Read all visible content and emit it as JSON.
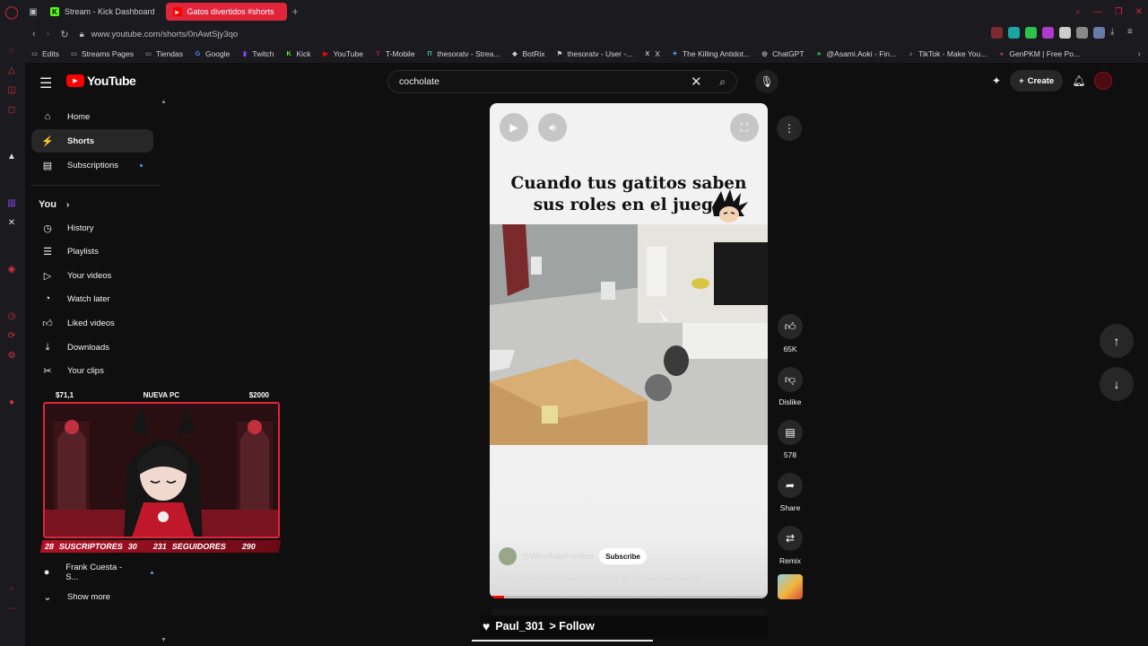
{
  "browser": {
    "tabs": [
      {
        "label": "Stream - Kick Dashboard",
        "active": false
      },
      {
        "label": "Gatos divertidos #shorts",
        "active": true
      }
    ],
    "url": "www.youtube.com/shorts/0nAwtSjy3qo",
    "bookmarks": [
      "Edits",
      "Streams Pages",
      "Tiendas",
      "Google",
      "Twitch",
      "Kick",
      "YouTube",
      "T-Mobile",
      "thesoratv - Strea...",
      "BotRix",
      "thesoratv - User -...",
      "X",
      "The Killing Antidot...",
      "ChatGPT",
      "@Asami.Aoki - Fin...",
      "TikTok - Make You...",
      "GenPKM | Free Po..."
    ]
  },
  "youtube": {
    "logo_text": "YouTube",
    "search_query": "cocholate",
    "create_label": "Create",
    "sidebar_top": [
      {
        "label": "Home",
        "icon": "home-icon"
      },
      {
        "label": "Shorts",
        "icon": "shorts-icon",
        "active": true
      },
      {
        "label": "Subscriptions",
        "icon": "subscriptions-icon",
        "dot": true
      }
    ],
    "you_label": "You",
    "sidebar_you": [
      {
        "label": "History",
        "icon": "history-icon"
      },
      {
        "label": "Playlists",
        "icon": "playlists-icon"
      },
      {
        "label": "Your videos",
        "icon": "your-videos-icon"
      },
      {
        "label": "Watch later",
        "icon": "watch-later-icon"
      },
      {
        "label": "Liked videos",
        "icon": "liked-videos-icon"
      },
      {
        "label": "Downloads",
        "icon": "downloads-icon"
      },
      {
        "label": "Your clips",
        "icon": "clips-icon"
      }
    ],
    "sidebar_bottom": [
      {
        "label": "Frank Cuesta - S...",
        "icon": "channel-avatar-icon",
        "dot": true
      },
      {
        "label": "Show more",
        "icon": "chevron-down-icon"
      }
    ]
  },
  "overlay": {
    "left_value": "$71,1",
    "center_text": "NUEVA PC",
    "right_value": "$2000",
    "subs_count": "28",
    "subs_label": "SUSCRIPTORES",
    "subs_goal": "30",
    "followers_count": "231",
    "followers_label": "SEGUIDORES",
    "followers_goal": "290"
  },
  "short": {
    "caption_line1": "Cuando tus gatitos saben",
    "caption_line2": "sus roles en el juego",
    "channel_handle": "@WhoAlanFonfico",
    "subscribe_label": "Subscribe",
    "title_text": "Gatos divertidos",
    "title_tags": "#shorts #viralshorts #dragonballz #goku",
    "progress": 0.05,
    "actions": [
      {
        "label": "65K",
        "icon": "like-icon"
      },
      {
        "label": "Dislike",
        "icon": "dislike-icon"
      },
      {
        "label": "578",
        "icon": "comments-icon"
      },
      {
        "label": "Share",
        "icon": "share-icon"
      },
      {
        "label": "Remix",
        "icon": "remix-icon"
      }
    ]
  },
  "follow_alert": {
    "user": "Paul_301",
    "text": "> Follow"
  },
  "colors": {
    "accent_red": "#e0243a",
    "yt_red": "#ff0000"
  }
}
